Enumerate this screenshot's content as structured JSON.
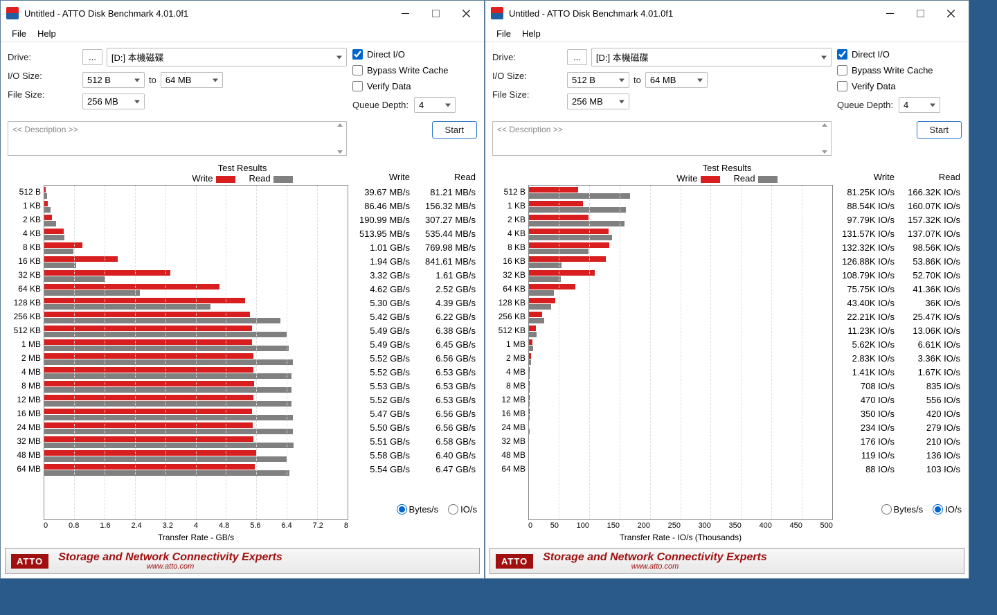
{
  "windows": [
    {
      "title": "Untitled - ATTO Disk Benchmark 4.01.0f1",
      "menu": {
        "file": "File",
        "help": "Help"
      },
      "labels": {
        "drive": "Drive:",
        "iosize": "I/O Size:",
        "to": "to",
        "filesize": "File Size:",
        "queue": "Queue Depth:"
      },
      "drive": "[D:] 本機磁碟",
      "io_from": "512 B",
      "io_to": "64 MB",
      "filesize": "256 MB",
      "queue": "4",
      "opts": {
        "direct": "Direct I/O",
        "bypass": "Bypass Write Cache",
        "verify": "Verify Data",
        "direct_checked": true
      },
      "desc_placeholder": "<< Description >>",
      "start": "Start",
      "results_title": "Test Results",
      "legend": {
        "write": "Write",
        "read": "Read"
      },
      "xaxis_label": "Transfer Rate - GB/s",
      "xticks": [
        "0",
        "0.8",
        "1.6",
        "2.4",
        "3.2",
        "4",
        "4.8",
        "5.6",
        "6.4",
        "7.2",
        "8"
      ],
      "radio": {
        "bytes": "Bytes/s",
        "ios": "IO/s",
        "selected": "bytes"
      },
      "col_hdr": {
        "write": "Write",
        "read": "Read"
      },
      "rows": [
        {
          "label": "512 B",
          "write": "39.67 MB/s",
          "read": "81.21 MB/s",
          "wb": 0.5,
          "rb": 1.0
        },
        {
          "label": "1 KB",
          "write": "86.46 MB/s",
          "read": "156.32 MB/s",
          "wb": 1.1,
          "rb": 2.0
        },
        {
          "label": "2 KB",
          "write": "190.99 MB/s",
          "read": "307.27 MB/s",
          "wb": 2.4,
          "rb": 3.8
        },
        {
          "label": "4 KB",
          "write": "513.95 MB/s",
          "read": "535.44 MB/s",
          "wb": 6.4,
          "rb": 6.7
        },
        {
          "label": "8 KB",
          "write": "1.01 GB/s",
          "read": "769.98 MB/s",
          "wb": 12.6,
          "rb": 9.6
        },
        {
          "label": "16 KB",
          "write": "1.94 GB/s",
          "read": "841.61 MB/s",
          "wb": 24.3,
          "rb": 10.5
        },
        {
          "label": "32 KB",
          "write": "3.32 GB/s",
          "read": "1.61 GB/s",
          "wb": 41.5,
          "rb": 20.1
        },
        {
          "label": "64 KB",
          "write": "4.62 GB/s",
          "read": "2.52 GB/s",
          "wb": 57.8,
          "rb": 31.5
        },
        {
          "label": "128 KB",
          "write": "5.30 GB/s",
          "read": "4.39 GB/s",
          "wb": 66.3,
          "rb": 54.9
        },
        {
          "label": "256 KB",
          "write": "5.42 GB/s",
          "read": "6.22 GB/s",
          "wb": 67.8,
          "rb": 77.8
        },
        {
          "label": "512 KB",
          "write": "5.49 GB/s",
          "read": "6.38 GB/s",
          "wb": 68.6,
          "rb": 79.8
        },
        {
          "label": "1 MB",
          "write": "5.49 GB/s",
          "read": "6.45 GB/s",
          "wb": 68.6,
          "rb": 80.6
        },
        {
          "label": "2 MB",
          "write": "5.52 GB/s",
          "read": "6.56 GB/s",
          "wb": 69.0,
          "rb": 82.0
        },
        {
          "label": "4 MB",
          "write": "5.52 GB/s",
          "read": "6.53 GB/s",
          "wb": 69.0,
          "rb": 81.6
        },
        {
          "label": "8 MB",
          "write": "5.53 GB/s",
          "read": "6.53 GB/s",
          "wb": 69.1,
          "rb": 81.6
        },
        {
          "label": "12 MB",
          "write": "5.52 GB/s",
          "read": "6.53 GB/s",
          "wb": 69.0,
          "rb": 81.6
        },
        {
          "label": "16 MB",
          "write": "5.47 GB/s",
          "read": "6.56 GB/s",
          "wb": 68.4,
          "rb": 82.0
        },
        {
          "label": "24 MB",
          "write": "5.50 GB/s",
          "read": "6.56 GB/s",
          "wb": 68.8,
          "rb": 82.0
        },
        {
          "label": "32 MB",
          "write": "5.51 GB/s",
          "read": "6.58 GB/s",
          "wb": 68.9,
          "rb": 82.3
        },
        {
          "label": "48 MB",
          "write": "5.58 GB/s",
          "read": "6.40 GB/s",
          "wb": 69.8,
          "rb": 80.0
        },
        {
          "label": "64 MB",
          "write": "5.54 GB/s",
          "read": "6.47 GB/s",
          "wb": 69.3,
          "rb": 80.9
        }
      ],
      "brand": {
        "logo": "ATTO",
        "tag": "Storage and Network Connectivity Experts",
        "url": "www.atto.com"
      }
    },
    {
      "title": "Untitled - ATTO Disk Benchmark 4.01.0f1",
      "menu": {
        "file": "File",
        "help": "Help"
      },
      "labels": {
        "drive": "Drive:",
        "iosize": "I/O Size:",
        "to": "to",
        "filesize": "File Size:",
        "queue": "Queue Depth:"
      },
      "drive": "[D:] 本機磁碟",
      "io_from": "512 B",
      "io_to": "64 MB",
      "filesize": "256 MB",
      "queue": "4",
      "opts": {
        "direct": "Direct I/O",
        "bypass": "Bypass Write Cache",
        "verify": "Verify Data",
        "direct_checked": true
      },
      "desc_placeholder": "<< Description >>",
      "start": "Start",
      "results_title": "Test Results",
      "legend": {
        "write": "Write",
        "read": "Read"
      },
      "xaxis_label": "Transfer Rate - IO/s (Thousands)",
      "xticks": [
        "0",
        "50",
        "100",
        "150",
        "200",
        "250",
        "300",
        "350",
        "400",
        "450",
        "500"
      ],
      "radio": {
        "bytes": "Bytes/s",
        "ios": "IO/s",
        "selected": "ios"
      },
      "col_hdr": {
        "write": "Write",
        "read": "Read"
      },
      "rows": [
        {
          "label": "512 B",
          "write": "81.25K IO/s",
          "read": "166.32K IO/s",
          "wb": 16.3,
          "rb": 33.3
        },
        {
          "label": "1 KB",
          "write": "88.54K IO/s",
          "read": "160.07K IO/s",
          "wb": 17.7,
          "rb": 32.0
        },
        {
          "label": "2 KB",
          "write": "97.79K IO/s",
          "read": "157.32K IO/s",
          "wb": 19.6,
          "rb": 31.5
        },
        {
          "label": "4 KB",
          "write": "131.57K IO/s",
          "read": "137.07K IO/s",
          "wb": 26.3,
          "rb": 27.4
        },
        {
          "label": "8 KB",
          "write": "132.32K IO/s",
          "read": "98.56K IO/s",
          "wb": 26.5,
          "rb": 19.7
        },
        {
          "label": "16 KB",
          "write": "126.88K IO/s",
          "read": "53.86K IO/s",
          "wb": 25.4,
          "rb": 10.8
        },
        {
          "label": "32 KB",
          "write": "108.79K IO/s",
          "read": "52.70K IO/s",
          "wb": 21.8,
          "rb": 10.5
        },
        {
          "label": "64 KB",
          "write": "75.75K IO/s",
          "read": "41.36K IO/s",
          "wb": 15.2,
          "rb": 8.3
        },
        {
          "label": "128 KB",
          "write": "43.40K IO/s",
          "read": "36K IO/s",
          "wb": 8.7,
          "rb": 7.2
        },
        {
          "label": "256 KB",
          "write": "22.21K IO/s",
          "read": "25.47K IO/s",
          "wb": 4.4,
          "rb": 5.1
        },
        {
          "label": "512 KB",
          "write": "11.23K IO/s",
          "read": "13.06K IO/s",
          "wb": 2.2,
          "rb": 2.6
        },
        {
          "label": "1 MB",
          "write": "5.62K IO/s",
          "read": "6.61K IO/s",
          "wb": 1.1,
          "rb": 1.3
        },
        {
          "label": "2 MB",
          "write": "2.83K IO/s",
          "read": "3.36K IO/s",
          "wb": 0.6,
          "rb": 0.7
        },
        {
          "label": "4 MB",
          "write": "1.41K IO/s",
          "read": "1.67K IO/s",
          "wb": 0.3,
          "rb": 0.3
        },
        {
          "label": "8 MB",
          "write": "708 IO/s",
          "read": "835 IO/s",
          "wb": 0.1,
          "rb": 0.2
        },
        {
          "label": "12 MB",
          "write": "470 IO/s",
          "read": "556 IO/s",
          "wb": 0.1,
          "rb": 0.1
        },
        {
          "label": "16 MB",
          "write": "350 IO/s",
          "read": "420 IO/s",
          "wb": 0.1,
          "rb": 0.1
        },
        {
          "label": "24 MB",
          "write": "234 IO/s",
          "read": "279 IO/s",
          "wb": 0,
          "rb": 0.1
        },
        {
          "label": "32 MB",
          "write": "176 IO/s",
          "read": "210 IO/s",
          "wb": 0,
          "rb": 0
        },
        {
          "label": "48 MB",
          "write": "119 IO/s",
          "read": "136 IO/s",
          "wb": 0,
          "rb": 0
        },
        {
          "label": "64 MB",
          "write": "88 IO/s",
          "read": "103 IO/s",
          "wb": 0,
          "rb": 0
        }
      ],
      "brand": {
        "logo": "ATTO",
        "tag": "Storage and Network Connectivity Experts",
        "url": "www.atto.com"
      }
    }
  ],
  "chart_data": [
    {
      "type": "bar",
      "orientation": "horizontal",
      "title": "Test Results",
      "xlabel": "Transfer Rate - GB/s",
      "xlim": [
        0,
        8
      ],
      "categories": [
        "512 B",
        "1 KB",
        "2 KB",
        "4 KB",
        "8 KB",
        "16 KB",
        "32 KB",
        "64 KB",
        "128 KB",
        "256 KB",
        "512 KB",
        "1 MB",
        "2 MB",
        "4 MB",
        "8 MB",
        "12 MB",
        "16 MB",
        "24 MB",
        "32 MB",
        "48 MB",
        "64 MB"
      ],
      "series": [
        {
          "name": "Write",
          "unit": "GB/s",
          "values": [
            0.03967,
            0.08646,
            0.19099,
            0.51395,
            1.01,
            1.94,
            3.32,
            4.62,
            5.3,
            5.42,
            5.49,
            5.49,
            5.52,
            5.52,
            5.53,
            5.52,
            5.47,
            5.5,
            5.51,
            5.58,
            5.54
          ]
        },
        {
          "name": "Read",
          "unit": "GB/s",
          "values": [
            0.08121,
            0.15632,
            0.30727,
            0.53544,
            0.76998,
            0.84161,
            1.61,
            2.52,
            4.39,
            6.22,
            6.38,
            6.45,
            6.56,
            6.53,
            6.53,
            6.53,
            6.56,
            6.56,
            6.58,
            6.4,
            6.47
          ]
        }
      ]
    },
    {
      "type": "bar",
      "orientation": "horizontal",
      "title": "Test Results",
      "xlabel": "Transfer Rate - IO/s (Thousands)",
      "xlim": [
        0,
        500
      ],
      "categories": [
        "512 B",
        "1 KB",
        "2 KB",
        "4 KB",
        "8 KB",
        "16 KB",
        "32 KB",
        "64 KB",
        "128 KB",
        "256 KB",
        "512 KB",
        "1 MB",
        "2 MB",
        "4 MB",
        "8 MB",
        "12 MB",
        "16 MB",
        "24 MB",
        "32 MB",
        "48 MB",
        "64 MB"
      ],
      "series": [
        {
          "name": "Write",
          "unit": "IO/s",
          "values": [
            81250,
            88540,
            97790,
            131570,
            132320,
            126880,
            108790,
            75750,
            43400,
            22210,
            11230,
            5620,
            2830,
            1410,
            708,
            470,
            350,
            234,
            176,
            119,
            88
          ]
        },
        {
          "name": "Read",
          "unit": "IO/s",
          "values": [
            166320,
            160070,
            157320,
            137070,
            98560,
            53860,
            52700,
            41360,
            36000,
            25470,
            13060,
            6610,
            3360,
            1670,
            835,
            556,
            420,
            279,
            210,
            136,
            103
          ]
        }
      ]
    }
  ]
}
